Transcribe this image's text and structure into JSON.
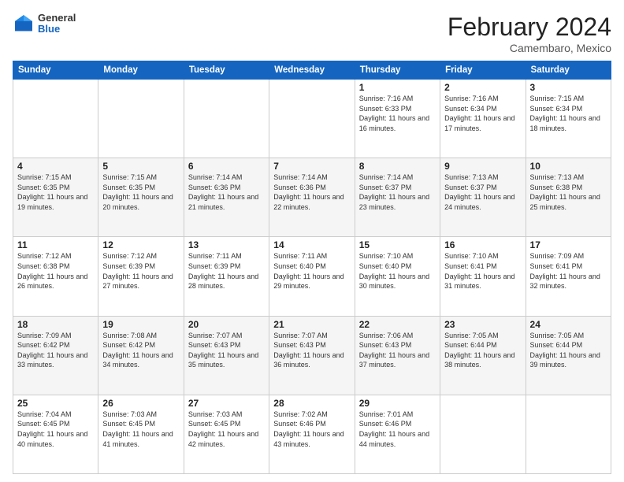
{
  "logo": {
    "general": "General",
    "blue": "Blue"
  },
  "header": {
    "month": "February 2024",
    "location": "Camembaro, Mexico"
  },
  "days": [
    "Sunday",
    "Monday",
    "Tuesday",
    "Wednesday",
    "Thursday",
    "Friday",
    "Saturday"
  ],
  "weeks": [
    [
      {
        "day": "",
        "sunrise": "",
        "sunset": "",
        "daylight": ""
      },
      {
        "day": "",
        "sunrise": "",
        "sunset": "",
        "daylight": ""
      },
      {
        "day": "",
        "sunrise": "",
        "sunset": "",
        "daylight": ""
      },
      {
        "day": "",
        "sunrise": "",
        "sunset": "",
        "daylight": ""
      },
      {
        "day": "1",
        "sunrise": "Sunrise: 7:16 AM",
        "sunset": "Sunset: 6:33 PM",
        "daylight": "Daylight: 11 hours and 16 minutes."
      },
      {
        "day": "2",
        "sunrise": "Sunrise: 7:16 AM",
        "sunset": "Sunset: 6:34 PM",
        "daylight": "Daylight: 11 hours and 17 minutes."
      },
      {
        "day": "3",
        "sunrise": "Sunrise: 7:15 AM",
        "sunset": "Sunset: 6:34 PM",
        "daylight": "Daylight: 11 hours and 18 minutes."
      }
    ],
    [
      {
        "day": "4",
        "sunrise": "Sunrise: 7:15 AM",
        "sunset": "Sunset: 6:35 PM",
        "daylight": "Daylight: 11 hours and 19 minutes."
      },
      {
        "day": "5",
        "sunrise": "Sunrise: 7:15 AM",
        "sunset": "Sunset: 6:35 PM",
        "daylight": "Daylight: 11 hours and 20 minutes."
      },
      {
        "day": "6",
        "sunrise": "Sunrise: 7:14 AM",
        "sunset": "Sunset: 6:36 PM",
        "daylight": "Daylight: 11 hours and 21 minutes."
      },
      {
        "day": "7",
        "sunrise": "Sunrise: 7:14 AM",
        "sunset": "Sunset: 6:36 PM",
        "daylight": "Daylight: 11 hours and 22 minutes."
      },
      {
        "day": "8",
        "sunrise": "Sunrise: 7:14 AM",
        "sunset": "Sunset: 6:37 PM",
        "daylight": "Daylight: 11 hours and 23 minutes."
      },
      {
        "day": "9",
        "sunrise": "Sunrise: 7:13 AM",
        "sunset": "Sunset: 6:37 PM",
        "daylight": "Daylight: 11 hours and 24 minutes."
      },
      {
        "day": "10",
        "sunrise": "Sunrise: 7:13 AM",
        "sunset": "Sunset: 6:38 PM",
        "daylight": "Daylight: 11 hours and 25 minutes."
      }
    ],
    [
      {
        "day": "11",
        "sunrise": "Sunrise: 7:12 AM",
        "sunset": "Sunset: 6:38 PM",
        "daylight": "Daylight: 11 hours and 26 minutes."
      },
      {
        "day": "12",
        "sunrise": "Sunrise: 7:12 AM",
        "sunset": "Sunset: 6:39 PM",
        "daylight": "Daylight: 11 hours and 27 minutes."
      },
      {
        "day": "13",
        "sunrise": "Sunrise: 7:11 AM",
        "sunset": "Sunset: 6:39 PM",
        "daylight": "Daylight: 11 hours and 28 minutes."
      },
      {
        "day": "14",
        "sunrise": "Sunrise: 7:11 AM",
        "sunset": "Sunset: 6:40 PM",
        "daylight": "Daylight: 11 hours and 29 minutes."
      },
      {
        "day": "15",
        "sunrise": "Sunrise: 7:10 AM",
        "sunset": "Sunset: 6:40 PM",
        "daylight": "Daylight: 11 hours and 30 minutes."
      },
      {
        "day": "16",
        "sunrise": "Sunrise: 7:10 AM",
        "sunset": "Sunset: 6:41 PM",
        "daylight": "Daylight: 11 hours and 31 minutes."
      },
      {
        "day": "17",
        "sunrise": "Sunrise: 7:09 AM",
        "sunset": "Sunset: 6:41 PM",
        "daylight": "Daylight: 11 hours and 32 minutes."
      }
    ],
    [
      {
        "day": "18",
        "sunrise": "Sunrise: 7:09 AM",
        "sunset": "Sunset: 6:42 PM",
        "daylight": "Daylight: 11 hours and 33 minutes."
      },
      {
        "day": "19",
        "sunrise": "Sunrise: 7:08 AM",
        "sunset": "Sunset: 6:42 PM",
        "daylight": "Daylight: 11 hours and 34 minutes."
      },
      {
        "day": "20",
        "sunrise": "Sunrise: 7:07 AM",
        "sunset": "Sunset: 6:43 PM",
        "daylight": "Daylight: 11 hours and 35 minutes."
      },
      {
        "day": "21",
        "sunrise": "Sunrise: 7:07 AM",
        "sunset": "Sunset: 6:43 PM",
        "daylight": "Daylight: 11 hours and 36 minutes."
      },
      {
        "day": "22",
        "sunrise": "Sunrise: 7:06 AM",
        "sunset": "Sunset: 6:43 PM",
        "daylight": "Daylight: 11 hours and 37 minutes."
      },
      {
        "day": "23",
        "sunrise": "Sunrise: 7:05 AM",
        "sunset": "Sunset: 6:44 PM",
        "daylight": "Daylight: 11 hours and 38 minutes."
      },
      {
        "day": "24",
        "sunrise": "Sunrise: 7:05 AM",
        "sunset": "Sunset: 6:44 PM",
        "daylight": "Daylight: 11 hours and 39 minutes."
      }
    ],
    [
      {
        "day": "25",
        "sunrise": "Sunrise: 7:04 AM",
        "sunset": "Sunset: 6:45 PM",
        "daylight": "Daylight: 11 hours and 40 minutes."
      },
      {
        "day": "26",
        "sunrise": "Sunrise: 7:03 AM",
        "sunset": "Sunset: 6:45 PM",
        "daylight": "Daylight: 11 hours and 41 minutes."
      },
      {
        "day": "27",
        "sunrise": "Sunrise: 7:03 AM",
        "sunset": "Sunset: 6:45 PM",
        "daylight": "Daylight: 11 hours and 42 minutes."
      },
      {
        "day": "28",
        "sunrise": "Sunrise: 7:02 AM",
        "sunset": "Sunset: 6:46 PM",
        "daylight": "Daylight: 11 hours and 43 minutes."
      },
      {
        "day": "29",
        "sunrise": "Sunrise: 7:01 AM",
        "sunset": "Sunset: 6:46 PM",
        "daylight": "Daylight: 11 hours and 44 minutes."
      },
      {
        "day": "",
        "sunrise": "",
        "sunset": "",
        "daylight": ""
      },
      {
        "day": "",
        "sunrise": "",
        "sunset": "",
        "daylight": ""
      }
    ]
  ]
}
